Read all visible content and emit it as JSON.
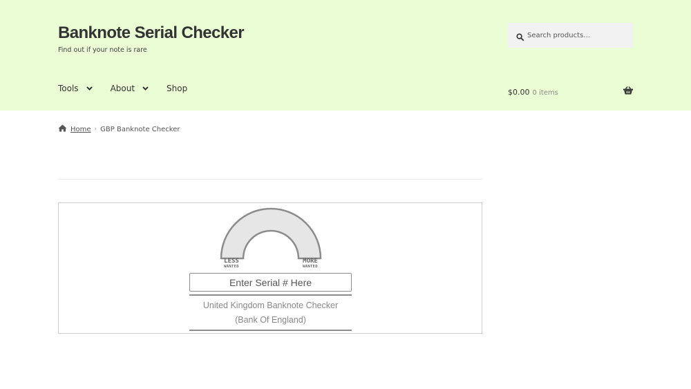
{
  "site": {
    "title": "Banknote Serial Checker",
    "tagline": "Find out if your note is rare"
  },
  "search": {
    "placeholder": "Search products…",
    "icon": "search-icon"
  },
  "nav": {
    "items": [
      {
        "label": "Tools",
        "has_dropdown": true
      },
      {
        "label": "About",
        "has_dropdown": true
      },
      {
        "label": "Shop",
        "has_dropdown": false
      }
    ]
  },
  "cart": {
    "amount": "$0.00",
    "items": "0 items",
    "icon": "basket-icon"
  },
  "breadcrumb": {
    "home": "Home",
    "current": "GBP Banknote Checker",
    "separator": "›"
  },
  "checker": {
    "gauge_left_big": "LESS",
    "gauge_left_small": "WANTED",
    "gauge_right_big": "MORE",
    "gauge_right_small": "WANTED",
    "input_placeholder": "Enter Serial # Here",
    "caption_line1": "United Kingdom Banknote Checker",
    "caption_line2": "(Bank Of England)"
  },
  "colors": {
    "header_bg": "#eafdd4",
    "text": "#333333",
    "gauge_fill": "#e6e6e6",
    "gauge_stroke": "#8c8c8c"
  }
}
